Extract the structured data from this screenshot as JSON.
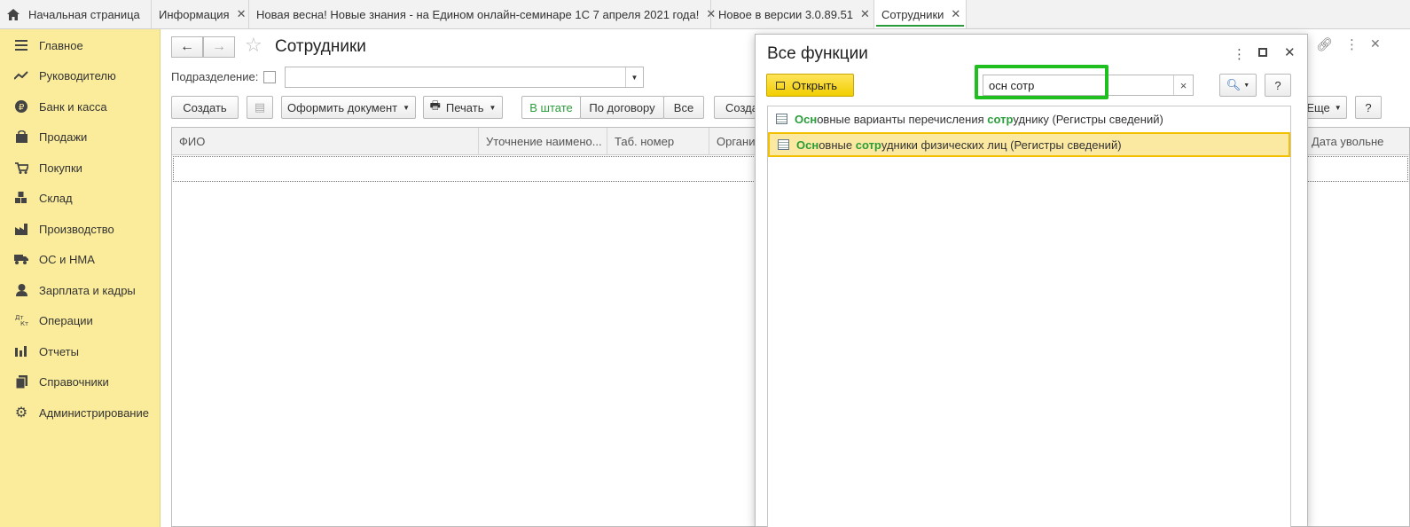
{
  "tabs": [
    {
      "label": "Начальная страница",
      "closable": false
    },
    {
      "label": "Информация",
      "closable": true
    },
    {
      "label": "Новая весна! Новые знания - на Едином онлайн-семинаре 1С 7 апреля 2021 года!",
      "closable": true
    },
    {
      "label": "Новое в версии 3.0.89.51",
      "closable": true
    },
    {
      "label": "Сотрудники",
      "closable": true,
      "active": true
    }
  ],
  "close_glyph": "✕",
  "sidebar": {
    "items": [
      {
        "label": "Главное",
        "icon": "menu-lines-icon"
      },
      {
        "label": "Руководителю",
        "icon": "trend-icon"
      },
      {
        "label": "Банк и касса",
        "icon": "ruble-coin-icon"
      },
      {
        "label": "Продажи",
        "icon": "bag-icon"
      },
      {
        "label": "Покупки",
        "icon": "cart-icon"
      },
      {
        "label": "Склад",
        "icon": "boxes-icon"
      },
      {
        "label": "Производство",
        "icon": "factory-icon"
      },
      {
        "label": "ОС и НМА",
        "icon": "truck-icon"
      },
      {
        "label": "Зарплата и кадры",
        "icon": "person-icon"
      },
      {
        "label": "Операции",
        "icon": "dt-kt-icon"
      },
      {
        "label": "Отчеты",
        "icon": "bar-chart-icon"
      },
      {
        "label": "Справочники",
        "icon": "books-icon"
      },
      {
        "label": "Администрирование",
        "icon": "gear-icon"
      }
    ]
  },
  "form": {
    "title": "Сотрудники",
    "subdivision_label": "Подразделение:",
    "subdivision_value": "",
    "toolbar": {
      "create": "Создать",
      "make_document": "Оформить документ",
      "print": "Печать",
      "filter_staff": "В штате",
      "filter_contract": "По договору",
      "filter_all": "Все",
      "create2": "Созда",
      "more": "Еще",
      "help": "?"
    },
    "columns": [
      "ФИО",
      "Уточнение наимено...",
      "Таб. номер",
      "Органи",
      "Дата увольне"
    ]
  },
  "dialog": {
    "title": "Все функции",
    "open_button": "Открыть",
    "search_value": "осн сотр",
    "clear_glyph": "×",
    "help": "?",
    "results": [
      {
        "parts": [
          {
            "t": "Осн",
            "h": true
          },
          {
            "t": "овные варианты перечисления ",
            "h": false
          },
          {
            "t": "сотр",
            "h": true
          },
          {
            "t": "уднику (Регистры сведений)",
            "h": false
          }
        ],
        "selected": false
      },
      {
        "parts": [
          {
            "t": "Осн",
            "h": true
          },
          {
            "t": "овные ",
            "h": false
          },
          {
            "t": "сотр",
            "h": true
          },
          {
            "t": "удники физических лиц (Регистры сведений)",
            "h": false
          }
        ],
        "selected": true
      }
    ]
  },
  "colors": {
    "sidebar_bg": "#fbec9b",
    "accent_green": "#2a9d3a",
    "highlight_box": "#1fbf1f",
    "selection_bg": "#fbe9a1",
    "open_button": "#f1ce00"
  }
}
